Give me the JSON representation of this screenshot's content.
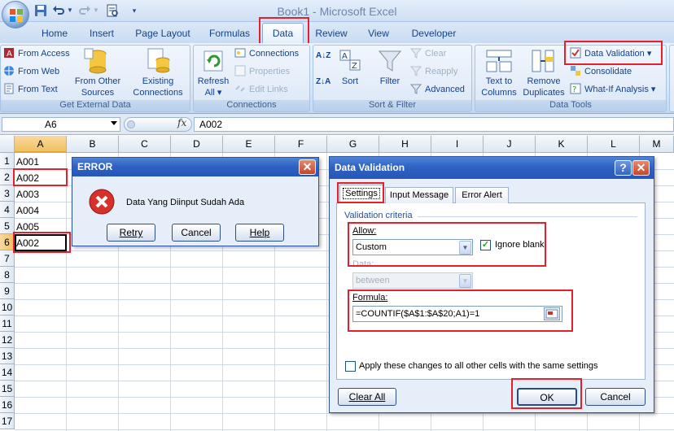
{
  "window": {
    "title": "Book1 - Microsoft Excel"
  },
  "quick_access": {
    "save_icon": "save-icon",
    "undo_icon": "undo-icon",
    "redo_icon": "redo-icon",
    "print_preview_icon": "print-preview-icon",
    "customize_icon": "customize-qat-icon"
  },
  "tabs": [
    "Home",
    "Insert",
    "Page Layout",
    "Formulas",
    "Data",
    "Review",
    "View",
    "Developer"
  ],
  "active_tab": "Data",
  "ribbon": {
    "get_external": {
      "label": "Get External Data",
      "from_access": "From Access",
      "from_web": "From Web",
      "from_text": "From Text",
      "from_other_1": "From Other",
      "from_other_2": "Sources",
      "existing_1": "Existing",
      "existing_2": "Connections"
    },
    "connections": {
      "label": "Connections",
      "refresh_1": "Refresh",
      "refresh_2": "All",
      "connections": "Connections",
      "properties": "Properties",
      "edit_links": "Edit Links"
    },
    "sort_filter": {
      "label": "Sort & Filter",
      "sort": "Sort",
      "filter": "Filter",
      "clear": "Clear",
      "reapply": "Reapply",
      "advanced": "Advanced"
    },
    "data_tools": {
      "label": "Data Tools",
      "text_to_1": "Text to",
      "text_to_2": "Columns",
      "remove_1": "Remove",
      "remove_2": "Duplicates",
      "data_validation": "Data Validation",
      "consolidate": "Consolidate",
      "what_if": "What-If Analysis"
    }
  },
  "formula_bar": {
    "name_box": "A6",
    "fx": "fx",
    "formula": "A002"
  },
  "columns": [
    "A",
    "B",
    "C",
    "D",
    "E",
    "F",
    "G",
    "H",
    "I",
    "J",
    "K",
    "L",
    "M"
  ],
  "rows": [
    "1",
    "2",
    "3",
    "4",
    "5",
    "6",
    "7",
    "8",
    "9",
    "10",
    "11",
    "12",
    "13",
    "14",
    "15",
    "16",
    "17"
  ],
  "cells": [
    "A001",
    "A002",
    "A003",
    "A004",
    "A005",
    "A002"
  ],
  "error_dialog": {
    "title": "ERROR",
    "message": "Data Yang Diinput Sudah Ada",
    "retry": "Retry",
    "cancel": "Cancel",
    "help": "Help"
  },
  "validation_dialog": {
    "title": "Data Validation",
    "tabs": [
      "Settings",
      "Input Message",
      "Error Alert"
    ],
    "criteria_label": "Validation criteria",
    "allow_label": "Allow:",
    "allow_value": "Custom",
    "ignore_blank": "Ignore blank",
    "data_label": "Data:",
    "data_value": "between",
    "formula_label": "Formula:",
    "formula_value": "=COUNTIF($A$1:$A$20;A1)=1",
    "apply_all": "Apply these changes to all other cells with the same settings",
    "clear_all": "Clear All",
    "ok": "OK",
    "cancel": "Cancel"
  },
  "colors": {
    "highlight": "#e4202c",
    "title_blue": "#2f62c4"
  }
}
